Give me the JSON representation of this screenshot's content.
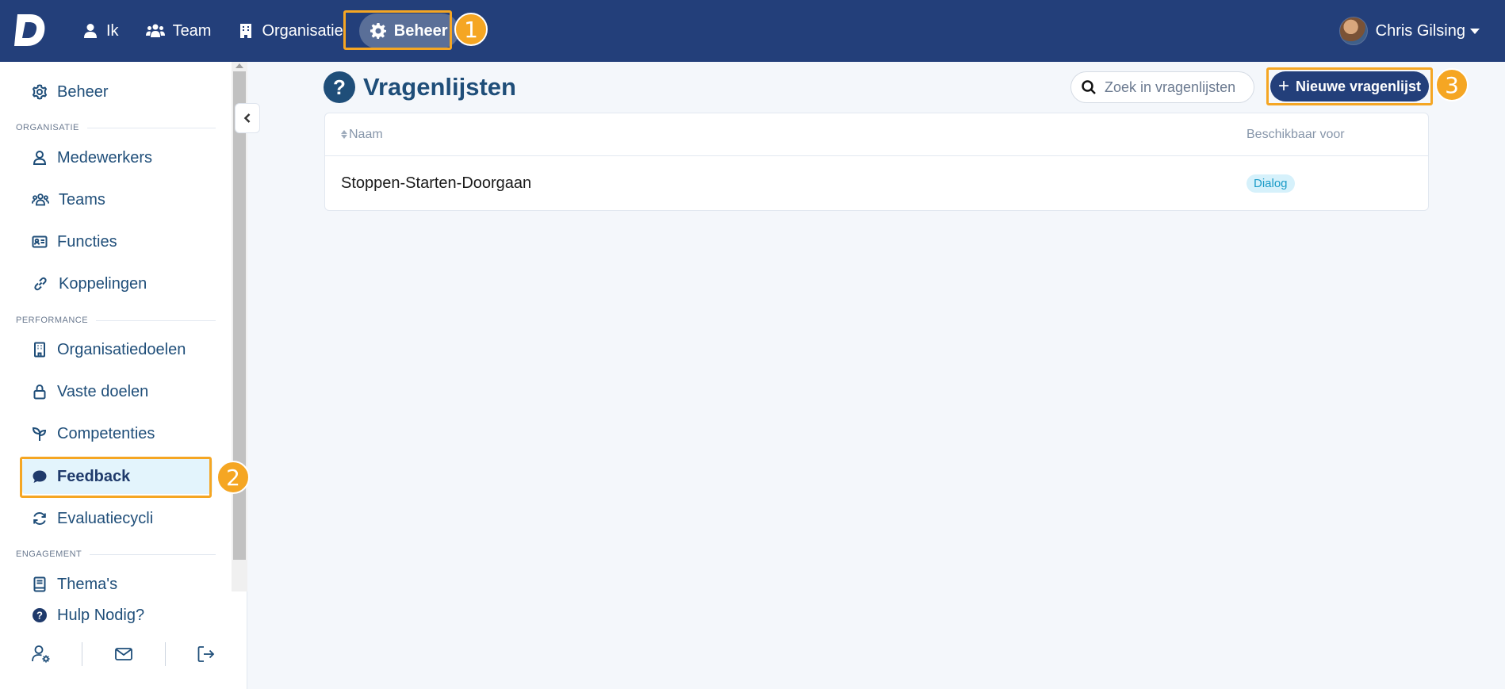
{
  "app": {
    "logo_letter": "D"
  },
  "topnav": {
    "items": [
      {
        "label": "Ik",
        "icon": "user-icon"
      },
      {
        "label": "Team",
        "icon": "users-icon"
      },
      {
        "label": "Organisatie",
        "icon": "building-icon"
      },
      {
        "label": "Beheer",
        "icon": "gear-icon",
        "active": true
      }
    ],
    "user_name": "Chris Gilsing"
  },
  "annotations": {
    "one": "1",
    "two": "2",
    "three": "3",
    "highlight_color": "#f5a623"
  },
  "sidebar": {
    "top_item": "Beheer",
    "sections": {
      "organisatie": "ORGANISATIE",
      "performance": "PERFORMANCE",
      "engagement": "ENGAGEMENT"
    },
    "items": {
      "medewerkers": "Medewerkers",
      "teams": "Teams",
      "functies": "Functies",
      "koppelingen": "Koppelingen",
      "organisatiedoelen": "Organisatiedoelen",
      "vaste_doelen": "Vaste doelen",
      "competenties": "Competenties",
      "feedback": "Feedback",
      "evaluatiecycli": "Evaluatiecycli",
      "themas": "Thema's",
      "hulp": "Hulp Nodig?"
    }
  },
  "main": {
    "title": "Vragenlijsten",
    "search_placeholder": "Zoek in vragenlijsten",
    "new_button": "Nieuwe vragenlijst",
    "table": {
      "col_name": "Naam",
      "col_available": "Beschikbaar voor",
      "rows": [
        {
          "name": "Stoppen-Starten-Doorgaan",
          "available": "Dialog"
        }
      ]
    }
  },
  "colors": {
    "navbar": "#233f7a",
    "accent": "#1f4e79",
    "tag_bg": "#d6f1fb",
    "tag_text": "#1a9bc7"
  }
}
